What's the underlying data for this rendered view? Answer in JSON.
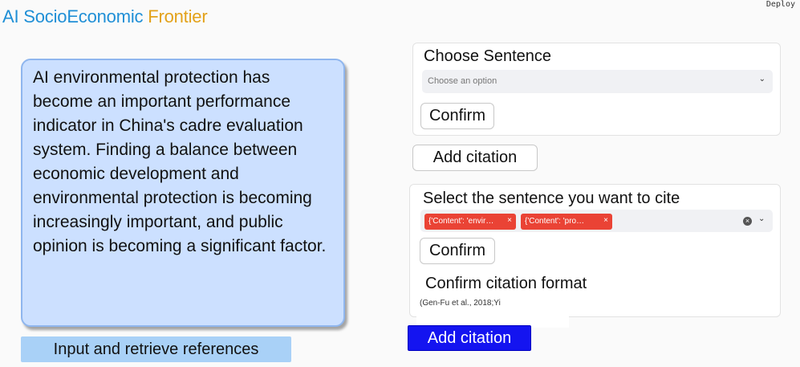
{
  "header": {
    "title_part1": "AI SocioEconomic",
    "title_part2": "Frontier",
    "deploy_label": "Deploy",
    "colors": {
      "title_blue": "#1f8fd6",
      "title_gold": "#e3a21a"
    }
  },
  "text_card": {
    "content": "AI environmental protection has become an important performance indicator in China's cadre evaluation system. Finding a balance between economic development and environmental protection is becoming increasingly important, and public opinion is becoming a significant factor."
  },
  "retrieve_button": {
    "label": "Input and retrieve references"
  },
  "choose_sentence": {
    "label": "Choose Sentence",
    "select_placeholder": "Choose an option",
    "confirm_label": "Confirm"
  },
  "add_citation_button": {
    "label": "Add citation"
  },
  "cite_section": {
    "label": "Select the sentence you want to cite",
    "tags": [
      {
        "label": "{'Content': 'envir…"
      },
      {
        "label": "{'Content': 'pro…"
      }
    ],
    "tag_remove_glyph": "×",
    "clear_glyph": "×",
    "confirm_label": "Confirm",
    "format_label": "Confirm citation format",
    "format_preview": "(Gen-Fu et al., 2018;Yi"
  },
  "add_citation_primary": {
    "label": "Add citation",
    "color": "#1414f0"
  },
  "icons": {
    "chevron_down": "⌄"
  }
}
